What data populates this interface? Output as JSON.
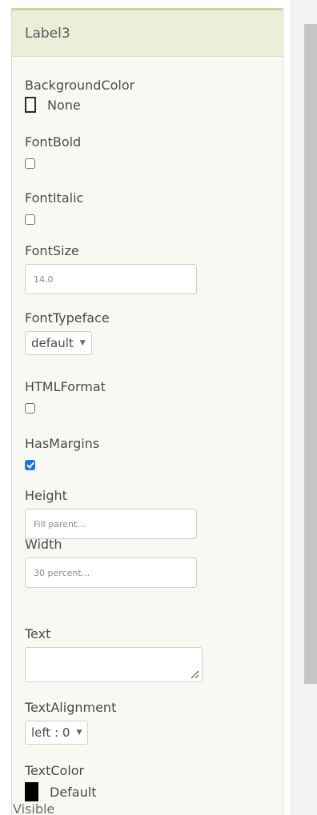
{
  "component": {
    "name": "Label3"
  },
  "properties": {
    "background_color": {
      "label": "BackgroundColor",
      "value": "None",
      "swatch": "#ffffff"
    },
    "font_bold": {
      "label": "FontBold",
      "checked": false
    },
    "font_italic": {
      "label": "FontItalic",
      "checked": false
    },
    "font_size": {
      "label": "FontSize",
      "value": "14.0"
    },
    "font_typeface": {
      "label": "FontTypeface",
      "value": "default"
    },
    "html_format": {
      "label": "HTMLFormat",
      "checked": false
    },
    "has_margins": {
      "label": "HasMargins",
      "checked": true
    },
    "height": {
      "label": "Height",
      "value": "Fill parent..."
    },
    "width": {
      "label": "Width",
      "value": "30 percent..."
    },
    "text": {
      "label": "Text",
      "value": ""
    },
    "text_alignment": {
      "label": "TextAlignment",
      "value": "left : 0"
    },
    "text_color": {
      "label": "TextColor",
      "value": "Default",
      "swatch": "#000000"
    },
    "visible": {
      "label": "Visible"
    }
  },
  "colors": {
    "header_bg": "#e9efd8",
    "panel_bg": "#f9f9f4",
    "checkbox_checked": "#1a73e8",
    "scrollbar_thumb": "#c5c5c5"
  },
  "icons": {
    "dropdown": "caret-down-icon",
    "checkmark": "check-icon",
    "resize": "resize-grip-icon"
  }
}
